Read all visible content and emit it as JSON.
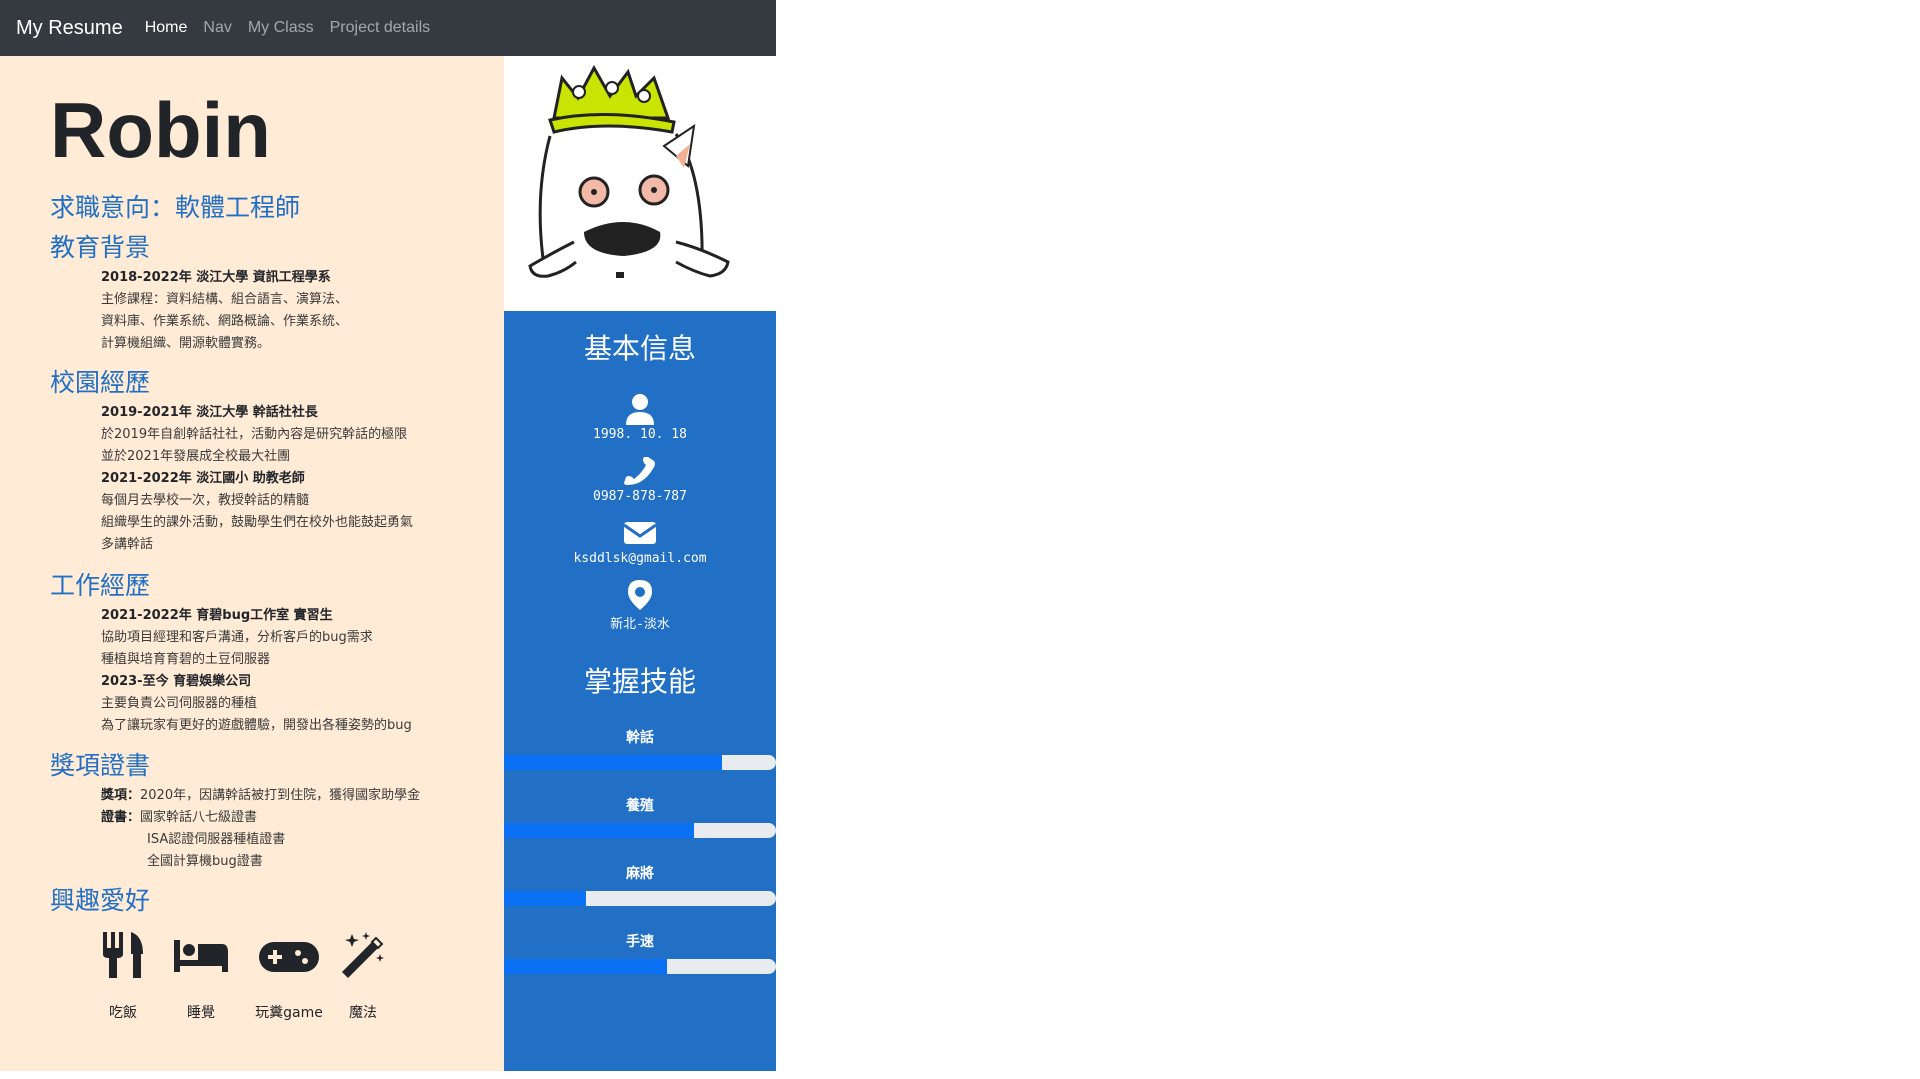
{
  "nav": {
    "brand": "My Resume",
    "links": [
      "Home",
      "Nav",
      "My Class",
      "Project details"
    ]
  },
  "name": "Robin",
  "job_intent": "求職意向：軟體工程師",
  "education": {
    "title": "教育背景",
    "heading": "2018-2022年  淡江大學  資訊工程學系",
    "lines": [
      "主修課程：資料結構、組合語言、演算法、",
      "資料庫、作業系統、網路概論、作業系統、",
      "計算機組織、開源軟體實務。"
    ]
  },
  "campus": {
    "title": "校園經歷",
    "heading1": "2019-2021年  淡江大學  幹話社社長",
    "lines1": [
      "於2019年自創幹話社社，活動內容是研究幹話的極限",
      "並於2021年發展成全校最大社團"
    ],
    "heading2": "2021-2022年  淡江國小  助教老師",
    "lines2": [
      "每個月去學校一次，教授幹話的精髓",
      "組織學生的課外活動，鼓勵學生們在校外也能鼓起勇氣",
      "多講幹話"
    ]
  },
  "work": {
    "title": "工作經歷",
    "heading1": "2021-2022年  育碧bug工作室  實習生",
    "lines1": [
      "協助項目經理和客戶溝通，分析客戶的bug需求",
      "種植與培育育碧的土豆伺服器"
    ],
    "heading2": "2023-至今  育碧娛樂公司",
    "lines2": [
      "主要負責公司伺服器的種植",
      "為了讓玩家有更好的遊戲體驗，開發出各種姿勢的bug"
    ]
  },
  "awards": {
    "title": "獎項證書",
    "award_label": "獎項：",
    "award_text": "2020年，因講幹話被打到住院，獲得國家助學金",
    "cert_label": "證書：",
    "certs": [
      "國家幹話八七級證書",
      "ISA認證伺服器種植證書",
      "全國計算機bug證書"
    ]
  },
  "hobbies": {
    "title": "興趣愛好",
    "items": [
      {
        "icon": "utensils-icon",
        "label": "吃飯"
      },
      {
        "icon": "bed-icon",
        "label": "睡覺"
      },
      {
        "icon": "gamepad-icon",
        "label": "玩糞game"
      },
      {
        "icon": "magic-wand-icon",
        "label": "魔法"
      }
    ]
  },
  "basic_info": {
    "title": "基本信息",
    "birthday": "1998. 10. 18",
    "phone": "0987-878-787",
    "email": "ksddlsk@gmail.com",
    "location": "新北-淡水"
  },
  "skills": {
    "title": "掌握技能",
    "items": [
      {
        "label": "幹話",
        "level": 0.8
      },
      {
        "label": "養殖",
        "level": 0.7
      },
      {
        "label": "麻將",
        "level": 0.3
      },
      {
        "label": "手速",
        "level": 0.6
      }
    ]
  },
  "colors": {
    "navbar": "#343a40",
    "left_bg": "#ffebd6",
    "accent_blue": "#2270c5",
    "skill_fill": "#0a71f5"
  }
}
